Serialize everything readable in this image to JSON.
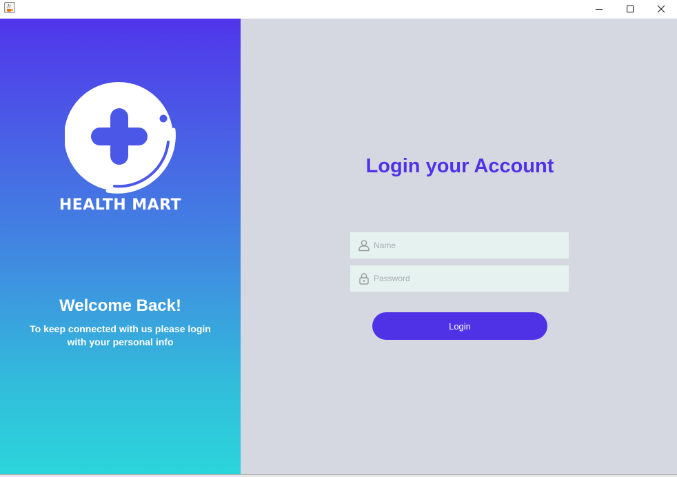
{
  "window": {
    "app_icon": "java-coffee-icon",
    "controls": [
      "minimize-icon",
      "maximize-icon",
      "close-icon"
    ]
  },
  "left_panel": {
    "brand_name": "HEALTH MART",
    "logo_icon": "medical-cross-logo",
    "welcome_title": "Welcome Back!",
    "welcome_text": "To keep connected with us please login with your personal info",
    "gradient_top": "#5035ea",
    "gradient_bottom": "#2bd5db"
  },
  "right_panel": {
    "title": "Login your Account",
    "name_field": {
      "placeholder": "Name",
      "value": "",
      "icon": "user-icon"
    },
    "password_field": {
      "placeholder": "Password",
      "value": "",
      "icon": "lock-icon"
    },
    "login_button": "Login",
    "accent_color": "#5032e6",
    "background": "#d6d8e1"
  }
}
